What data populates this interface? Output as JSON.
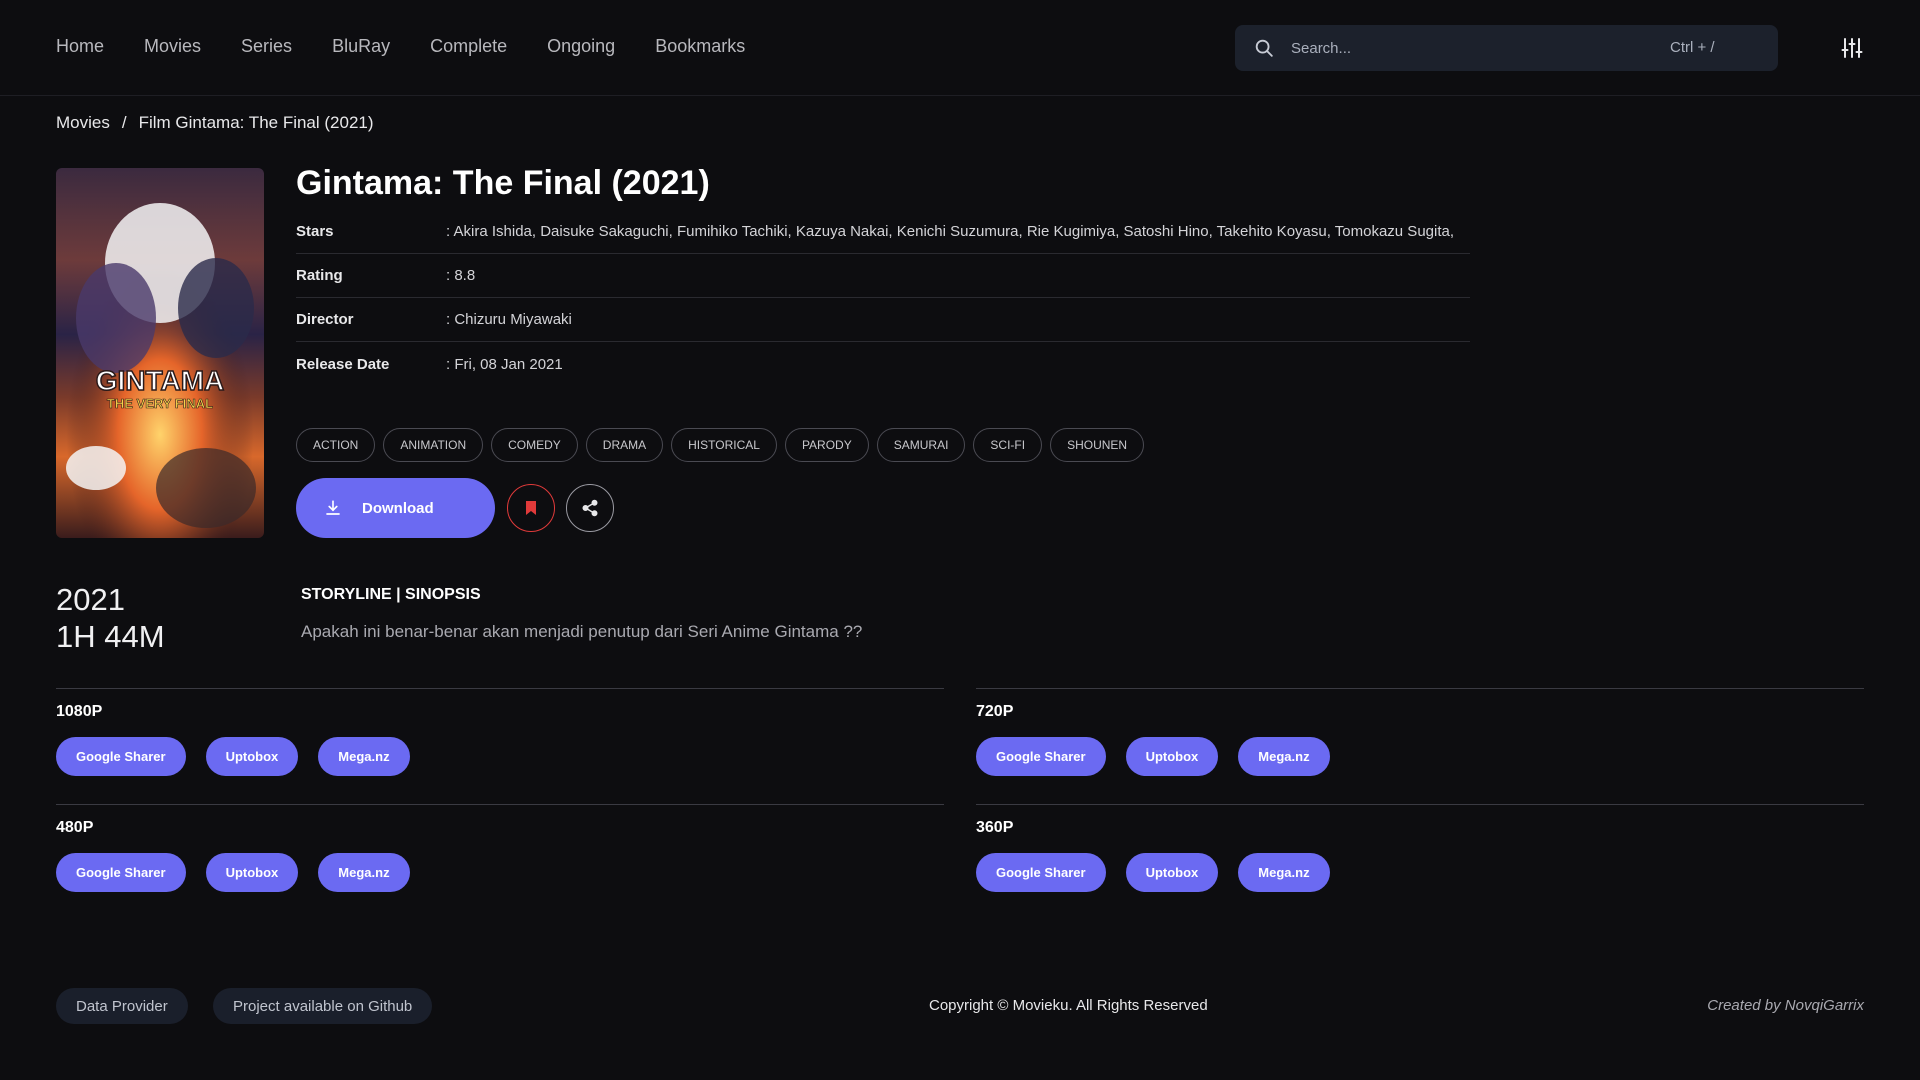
{
  "nav": {
    "items": [
      {
        "label": "Home"
      },
      {
        "label": "Movies"
      },
      {
        "label": "Series"
      },
      {
        "label": "BluRay"
      },
      {
        "label": "Complete"
      },
      {
        "label": "Ongoing"
      },
      {
        "label": "Bookmarks"
      }
    ]
  },
  "search": {
    "placeholder": "Search...",
    "shortcut": "Ctrl + /"
  },
  "breadcrumb": {
    "parent": "Movies",
    "separator": "/",
    "current": "Film Gintama: The Final (2021)"
  },
  "movie": {
    "title": "Gintama: The Final (2021)",
    "poster_text_1": "GINTAMA",
    "poster_text_2": "THE VERY FINAL",
    "info": [
      {
        "key": "Stars",
        "value": ": Akira Ishida, Daisuke Sakaguchi, Fumihiko Tachiki, Kazuya Nakai, Kenichi Suzumura, Rie Kugimiya, Satoshi Hino, Takehito Koyasu, Tomokazu Sugita,"
      },
      {
        "key": "Rating",
        "value": ": 8.8"
      },
      {
        "key": "Director",
        "value": ": Chizuru Miyawaki"
      },
      {
        "key": "Release Date",
        "value": ": Fri, 08 Jan 2021"
      }
    ],
    "tags": [
      "ACTION",
      "ANIMATION",
      "COMEDY",
      "DRAMA",
      "HISTORICAL",
      "PARODY",
      "SAMURAI",
      "SCI-FI",
      "SHOUNEN"
    ],
    "download_label": "Download",
    "year": "2021",
    "duration": "1H 44M",
    "storyline_heading": "STORYLINE | SINOPSIS",
    "storyline_text": "Apakah ini benar-benar akan menjadi penutup dari Seri Anime Gintama ??"
  },
  "downloads": [
    {
      "quality": "1080P",
      "links": [
        "Google Sharer",
        "Uptobox",
        "Mega.nz"
      ]
    },
    {
      "quality": "720P",
      "links": [
        "Google Sharer",
        "Uptobox",
        "Mega.nz"
      ]
    },
    {
      "quality": "480P",
      "links": [
        "Google Sharer",
        "Uptobox",
        "Mega.nz"
      ]
    },
    {
      "quality": "360P",
      "links": [
        "Google Sharer",
        "Uptobox",
        "Mega.nz"
      ]
    }
  ],
  "footer": {
    "data_provider": "Data Provider",
    "github": "Project available on Github",
    "copyright": "Copyright © Movieku. All Rights Reserved",
    "credit": "Created by NovqiGarrix"
  },
  "colors": {
    "accent": "#6b6af2",
    "bookmark": "#e03a3a",
    "background": "#0d0d10"
  }
}
